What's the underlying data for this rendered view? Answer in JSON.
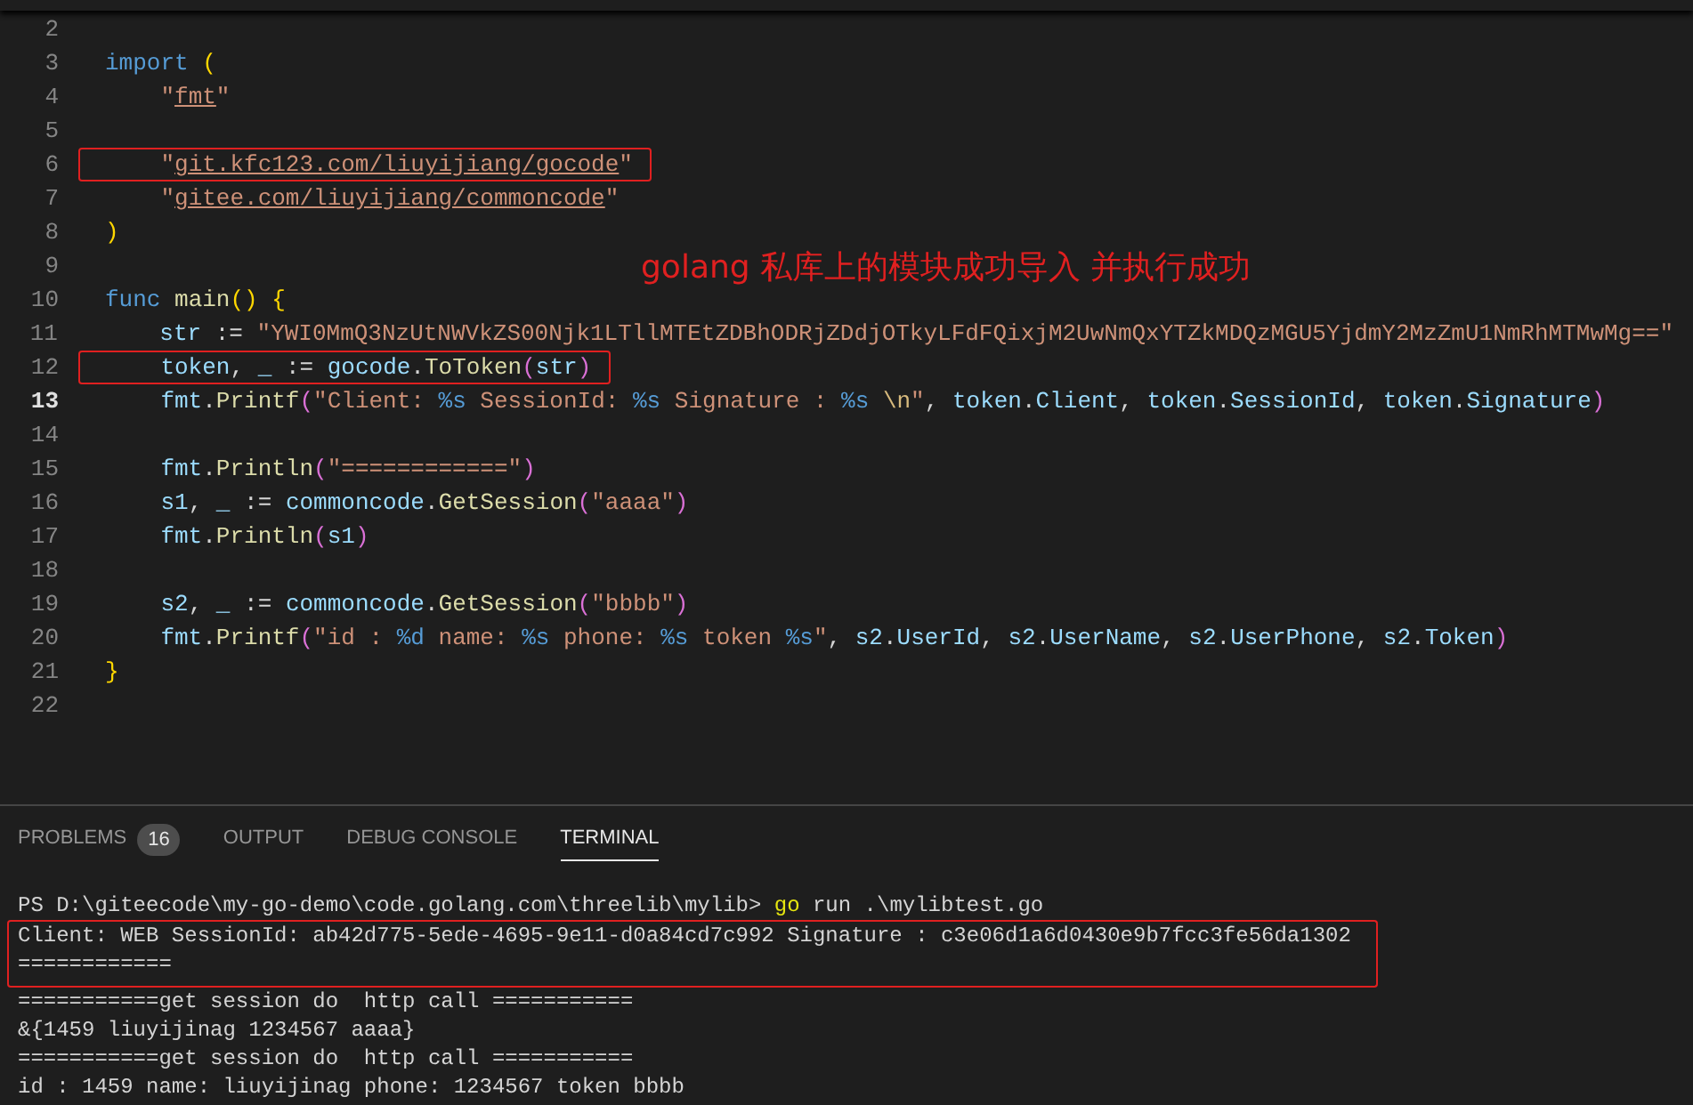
{
  "editor": {
    "lines": [
      {
        "number": "2",
        "current": false
      },
      {
        "number": "3",
        "current": false,
        "boxed": false,
        "tokens": [
          {
            "text": "import",
            "kind": "keyword"
          },
          {
            "text": " (",
            "kind": "bracket"
          }
        ]
      },
      {
        "number": "4",
        "current": false,
        "boxed": false,
        "tokens": [
          {
            "text": "    \"",
            "kind": "string"
          },
          {
            "text": "fmt",
            "kind": "link"
          },
          {
            "text": "\"",
            "kind": "string"
          }
        ]
      },
      {
        "number": "5",
        "current": false
      },
      {
        "number": "6",
        "current": false,
        "boxed": true,
        "tokens": [
          {
            "text": "    \"",
            "kind": "string"
          },
          {
            "text": "git.kfc123.com/liuyijiang/gocode",
            "kind": "link"
          },
          {
            "text": "\"",
            "kind": "string"
          }
        ]
      },
      {
        "number": "7",
        "current": false,
        "boxed": false,
        "tokens": [
          {
            "text": "    \"",
            "kind": "string"
          },
          {
            "text": "gitee.com/liuyijiang/commoncode",
            "kind": "link"
          },
          {
            "text": "\"",
            "kind": "string"
          }
        ]
      },
      {
        "number": "8",
        "current": false,
        "boxed": false,
        "tokens": [
          {
            "text": ")",
            "kind": "bracket"
          }
        ]
      },
      {
        "number": "9",
        "current": false
      },
      {
        "number": "10",
        "current": false,
        "boxed": false,
        "tokens": [
          {
            "text": "func",
            "kind": "keyword"
          },
          {
            "text": " main",
            "kind": "func"
          },
          {
            "text": "() {",
            "kind": "bracket"
          }
        ]
      },
      {
        "number": "11",
        "current": false,
        "boxed": false,
        "tokens": [
          {
            "text": "    str",
            "kind": "var"
          },
          {
            "text": " := ",
            "kind": "plain"
          },
          {
            "text": "\"YWI0MmQ3NzUtNWVkZS00Njk1LTllMTEtZDBhODRjZDdjOTkyLFdFQixjM2UwNmQxYTZkMDQzMGU5YjdmY2MzZmU1NmRhMTMwMg==\"",
            "kind": "string"
          }
        ]
      },
      {
        "number": "12",
        "current": false,
        "boxed": true,
        "tokens": [
          {
            "text": "    token",
            "kind": "var"
          },
          {
            "text": ", ",
            "kind": "plain"
          },
          {
            "text": "_",
            "kind": "var"
          },
          {
            "text": " := ",
            "kind": "plain"
          },
          {
            "text": "gocode",
            "kind": "var"
          },
          {
            "text": ".",
            "kind": "plain"
          },
          {
            "text": "ToToken",
            "kind": "func"
          },
          {
            "text": "(",
            "kind": "paren"
          },
          {
            "text": "str",
            "kind": "var"
          },
          {
            "text": ")",
            "kind": "paren"
          }
        ]
      },
      {
        "number": "13",
        "current": true,
        "boxed": false,
        "tokens": [
          {
            "text": "    fmt",
            "kind": "var"
          },
          {
            "text": ".",
            "kind": "plain"
          },
          {
            "text": "Printf",
            "kind": "func"
          },
          {
            "text": "(",
            "kind": "paren"
          },
          {
            "text": "\"Client: ",
            "kind": "string"
          },
          {
            "text": "%s",
            "kind": "format"
          },
          {
            "text": " SessionId: ",
            "kind": "string"
          },
          {
            "text": "%s",
            "kind": "format"
          },
          {
            "text": " Signature : ",
            "kind": "string"
          },
          {
            "text": "%s",
            "kind": "format"
          },
          {
            "text": " \\n",
            "kind": "escape"
          },
          {
            "text": "\"",
            "kind": "string"
          },
          {
            "text": ", ",
            "kind": "plain"
          },
          {
            "text": "token",
            "kind": "var"
          },
          {
            "text": ".",
            "kind": "plain"
          },
          {
            "text": "Client",
            "kind": "var"
          },
          {
            "text": ", ",
            "kind": "plain"
          },
          {
            "text": "token",
            "kind": "var"
          },
          {
            "text": ".",
            "kind": "plain"
          },
          {
            "text": "SessionId",
            "kind": "var"
          },
          {
            "text": ", ",
            "kind": "plain"
          },
          {
            "text": "token",
            "kind": "var"
          },
          {
            "text": ".",
            "kind": "plain"
          },
          {
            "text": "Signature",
            "kind": "var"
          },
          {
            "text": ")",
            "kind": "paren"
          }
        ]
      },
      {
        "number": "14",
        "current": false
      },
      {
        "number": "15",
        "current": false,
        "boxed": false,
        "tokens": [
          {
            "text": "    fmt",
            "kind": "var"
          },
          {
            "text": ".",
            "kind": "plain"
          },
          {
            "text": "Println",
            "kind": "func"
          },
          {
            "text": "(",
            "kind": "paren"
          },
          {
            "text": "\"============\"",
            "kind": "string"
          },
          {
            "text": ")",
            "kind": "paren"
          }
        ]
      },
      {
        "number": "16",
        "current": false,
        "boxed": false,
        "tokens": [
          {
            "text": "    s1",
            "kind": "var"
          },
          {
            "text": ", ",
            "kind": "plain"
          },
          {
            "text": "_",
            "kind": "var"
          },
          {
            "text": " := ",
            "kind": "plain"
          },
          {
            "text": "commoncode",
            "kind": "var"
          },
          {
            "text": ".",
            "kind": "plain"
          },
          {
            "text": "GetSession",
            "kind": "func"
          },
          {
            "text": "(",
            "kind": "paren"
          },
          {
            "text": "\"aaaa\"",
            "kind": "string"
          },
          {
            "text": ")",
            "kind": "paren"
          }
        ]
      },
      {
        "number": "17",
        "current": false,
        "boxed": false,
        "tokens": [
          {
            "text": "    fmt",
            "kind": "var"
          },
          {
            "text": ".",
            "kind": "plain"
          },
          {
            "text": "Println",
            "kind": "func"
          },
          {
            "text": "(",
            "kind": "paren"
          },
          {
            "text": "s1",
            "kind": "var"
          },
          {
            "text": ")",
            "kind": "paren"
          }
        ]
      },
      {
        "number": "18",
        "current": false
      },
      {
        "number": "19",
        "current": false,
        "boxed": false,
        "tokens": [
          {
            "text": "    s2",
            "kind": "var"
          },
          {
            "text": ", ",
            "kind": "plain"
          },
          {
            "text": "_",
            "kind": "var"
          },
          {
            "text": " := ",
            "kind": "plain"
          },
          {
            "text": "commoncode",
            "kind": "var"
          },
          {
            "text": ".",
            "kind": "plain"
          },
          {
            "text": "GetSession",
            "kind": "func"
          },
          {
            "text": "(",
            "kind": "paren"
          },
          {
            "text": "\"bbbb\"",
            "kind": "string"
          },
          {
            "text": ")",
            "kind": "paren"
          }
        ]
      },
      {
        "number": "20",
        "current": false,
        "boxed": false,
        "tokens": [
          {
            "text": "    fmt",
            "kind": "var"
          },
          {
            "text": ".",
            "kind": "plain"
          },
          {
            "text": "Printf",
            "kind": "func"
          },
          {
            "text": "(",
            "kind": "paren"
          },
          {
            "text": "\"id : ",
            "kind": "string"
          },
          {
            "text": "%d",
            "kind": "format"
          },
          {
            "text": " name: ",
            "kind": "string"
          },
          {
            "text": "%s",
            "kind": "format"
          },
          {
            "text": " phone: ",
            "kind": "string"
          },
          {
            "text": "%s",
            "kind": "format"
          },
          {
            "text": " token ",
            "kind": "string"
          },
          {
            "text": "%s",
            "kind": "format"
          },
          {
            "text": "\"",
            "kind": "string"
          },
          {
            "text": ", ",
            "kind": "plain"
          },
          {
            "text": "s2",
            "kind": "var"
          },
          {
            "text": ".",
            "kind": "plain"
          },
          {
            "text": "UserId",
            "kind": "var"
          },
          {
            "text": ", ",
            "kind": "plain"
          },
          {
            "text": "s2",
            "kind": "var"
          },
          {
            "text": ".",
            "kind": "plain"
          },
          {
            "text": "UserName",
            "kind": "var"
          },
          {
            "text": ", ",
            "kind": "plain"
          },
          {
            "text": "s2",
            "kind": "var"
          },
          {
            "text": ".",
            "kind": "plain"
          },
          {
            "text": "UserPhone",
            "kind": "var"
          },
          {
            "text": ", ",
            "kind": "plain"
          },
          {
            "text": "s2",
            "kind": "var"
          },
          {
            "text": ".",
            "kind": "plain"
          },
          {
            "text": "Token",
            "kind": "var"
          },
          {
            "text": ")",
            "kind": "paren"
          }
        ]
      },
      {
        "number": "21",
        "current": false,
        "boxed": false,
        "tokens": [
          {
            "text": "}",
            "kind": "bracket"
          }
        ]
      },
      {
        "number": "22",
        "current": false
      }
    ],
    "annotation": "golang 私库上的模块成功导入 并执行成功"
  },
  "panel": {
    "tabs": [
      {
        "label": "PROBLEMS",
        "badge": "16",
        "selected": false
      },
      {
        "label": "OUTPUT",
        "selected": false
      },
      {
        "label": "DEBUG CONSOLE",
        "selected": false
      },
      {
        "label": "TERMINAL",
        "selected": true
      }
    ],
    "terminal": [
      {
        "boxed": false,
        "tokens": [
          {
            "text": "PS D:\\giteecode\\my-go-demo\\code.golang.com\\threelib\\mylib> ",
            "kind": "plain"
          },
          {
            "text": "go",
            "kind": "command"
          },
          {
            "text": " run .\\mylibtest.go",
            "kind": "plain"
          }
        ]
      },
      {
        "boxed": true,
        "tokens": [
          {
            "text": "Client: WEB SessionId: ab42d775-5ede-4695-9e11-d0a84cd7c992 Signature : c3e06d1a6d0430e9b7fcc3fe56da1302",
            "kind": "plain"
          }
        ]
      },
      {
        "boxed": true,
        "tokens": [
          {
            "text": "============",
            "kind": "plain"
          }
        ]
      },
      {
        "boxed": false,
        "tokens": [
          {
            "text": "===========get session do  http call ===========",
            "kind": "plain"
          }
        ]
      },
      {
        "boxed": false,
        "tokens": [
          {
            "text": "&{1459 liuyijinag 1234567 aaaa}",
            "kind": "plain"
          }
        ]
      },
      {
        "boxed": false,
        "tokens": [
          {
            "text": "===========get session do  http call ===========",
            "kind": "plain"
          }
        ]
      },
      {
        "boxed": false,
        "tokens": [
          {
            "text": "id : 1459 name: liuyijinag phone: 1234567 token bbbb",
            "kind": "plain"
          }
        ]
      }
    ]
  }
}
